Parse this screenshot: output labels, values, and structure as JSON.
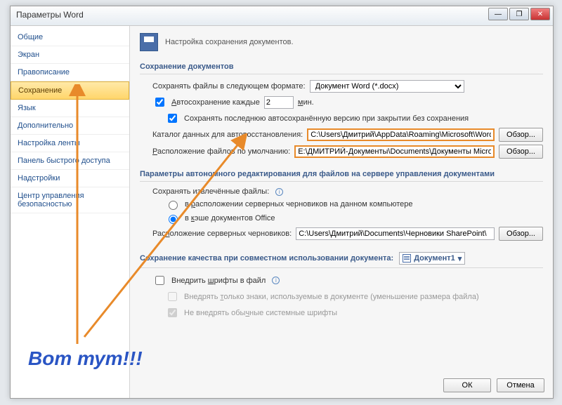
{
  "window": {
    "title": "Параметры Word"
  },
  "win_controls": {
    "min": "—",
    "max": "❐",
    "close": "✕"
  },
  "sidebar": {
    "items": [
      {
        "label": "Общие"
      },
      {
        "label": "Экран"
      },
      {
        "label": "Правописание"
      },
      {
        "label": "Сохранение",
        "selected": true
      },
      {
        "label": "Язык"
      },
      {
        "label": "Дополнительно"
      },
      {
        "label": "Настройка ленты"
      },
      {
        "label": "Панель быстрого доступа"
      },
      {
        "label": "Надстройки"
      },
      {
        "label": "Центр управления безопасностью"
      }
    ]
  },
  "header": {
    "text": "Настройка сохранения документов."
  },
  "sec1": {
    "title": "Сохранение документов",
    "save_format_label": "Сохранять файлы в следующем формате:",
    "save_format_value": "Документ Word (*.docx)",
    "autosave_label1": "Автосохранение каждые",
    "autosave_value": "2",
    "autosave_label2": "мин.",
    "keep_last_autosave": "Сохранять последнюю автосохранённую версию при закрытии без сохранения",
    "recovery_dir_label": "Каталог данных для автовосстановления:",
    "recovery_dir_value": "C:\\Users\\Дмитрий\\AppData\\Roaming\\Microsoft\\Word\\",
    "default_loc_label": "Расположение файлов по умолчанию:",
    "default_loc_value": "E:\\ДМИТРИЙ-Документы\\Documents\\Документы Microsoft Word",
    "browse": "Обзор..."
  },
  "sec2": {
    "title": "Параметры автономного редактирования для файлов на сервере управления документами",
    "save_checked_label": "Сохранять извлечённые файлы:",
    "radio1": "в расположении серверных черновиков на данном компьютере",
    "radio2": "в кэше документов Office",
    "drafts_loc_label": "Расположение серверных черновиков:",
    "drafts_loc_value": "C:\\Users\\Дмитрий\\Documents\\Черновики SharePoint\\",
    "browse": "Обзор..."
  },
  "sec3": {
    "title_label": "Сохранение качества при совместном использовании документа:",
    "doc_name": "Документ1",
    "embed_fonts": "Внедрить шрифты в файл",
    "embed_only_used": "Внедрять только знаки, используемые в документе (уменьшение размера файла)",
    "no_embed_system": "Не внедрять обычные системные шрифты"
  },
  "footer": {
    "ok": "ОК",
    "cancel": "Отмена"
  },
  "annotation": {
    "text": "Вот тут!!!"
  }
}
